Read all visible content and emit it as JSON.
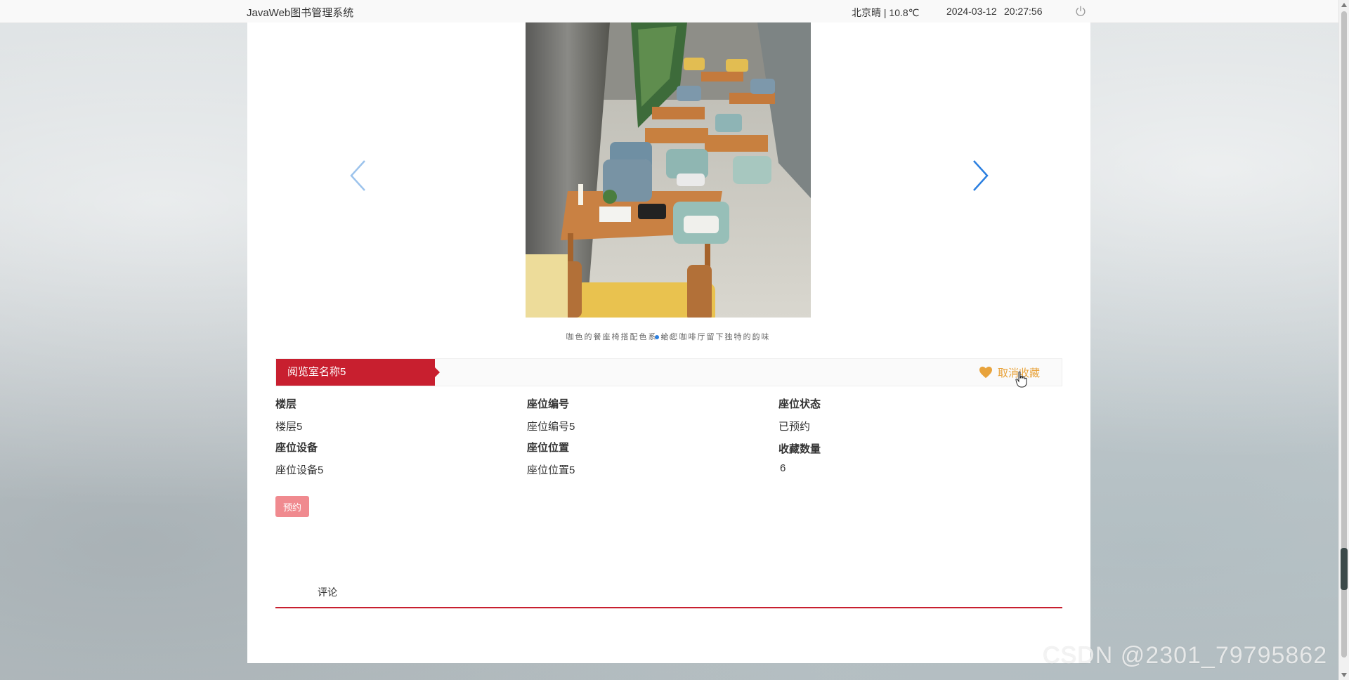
{
  "header": {
    "site_title": "JavaWeb图书管理系统",
    "weather": "北京晴 | 10.8℃",
    "date": "2024-03-12",
    "time": "20:27:56",
    "power_icon": "power-icon"
  },
  "carousel": {
    "caption": "咖色的餐座椅搭配色系 给您咖啡厅留下独特的韵味",
    "slide_count": 3,
    "active_index": 0
  },
  "room": {
    "name": "阅览室名称5",
    "favorite_label": "取消收藏",
    "favorite_icon": "heart-icon"
  },
  "attributes": [
    {
      "label": "楼层",
      "value": "楼层5"
    },
    {
      "label": "座位编号",
      "value": "座位编号5"
    },
    {
      "label": "座位状态",
      "value": "已预约"
    },
    {
      "label": "座位设备",
      "value": "座位设备5"
    },
    {
      "label": "座位位置",
      "value": "座位位置5"
    },
    {
      "label": "收藏数量",
      "value": "6"
    }
  ],
  "actions": {
    "reserve_label": "预约"
  },
  "tabs": {
    "comment": "评论"
  },
  "watermark": "CSDN @2301_79795862",
  "colors": {
    "brand_red": "#c81f2f",
    "favorite_orange": "#e8a33c",
    "carousel_blue": "#2b7fe0"
  }
}
